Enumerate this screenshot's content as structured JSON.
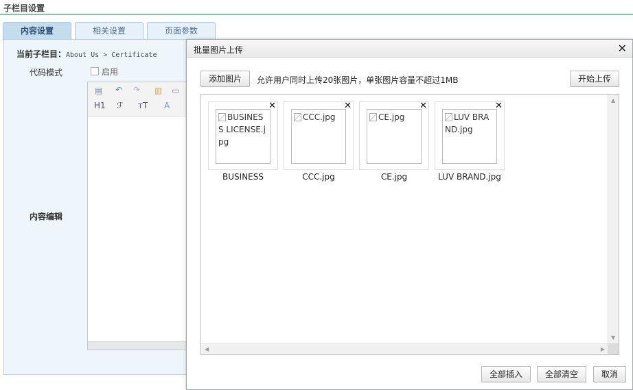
{
  "page": {
    "title": "子栏目设置"
  },
  "tabs": [
    {
      "label": "内容设置",
      "active": true
    },
    {
      "label": "相关设置",
      "active": false
    },
    {
      "label": "页面参数",
      "active": false
    }
  ],
  "form": {
    "crumb_label": "当前子栏目：",
    "crumb_path": "About Us > Certificate",
    "code_mode_label": "代码模式",
    "enable_label": "启用",
    "content_edit_label": "内容编辑"
  },
  "editor_toolbar": {
    "heading": "H1",
    "font": "ℱ",
    "font_size": "тT",
    "font_color": "A"
  },
  "dialog": {
    "title": "批量图片上传",
    "close_glyph": "✕",
    "add_button": "添加图片",
    "hint": "允许用户同时上传20张图片，单张图片容量不超过1MB",
    "start_button": "开始上传",
    "insert_all_button": "全部插入",
    "clear_all_button": "全部清空",
    "cancel_button": "取消",
    "images": [
      {
        "alt": "BUSINESS LICENSE.jpg",
        "name": "BUSINESS"
      },
      {
        "alt": "CCC.jpg",
        "name": "CCC.jpg"
      },
      {
        "alt": "CE.jpg",
        "name": "CE.jpg"
      },
      {
        "alt": "LUV BRAND.jpg",
        "name": "LUV BRAND.jpg"
      }
    ]
  }
}
